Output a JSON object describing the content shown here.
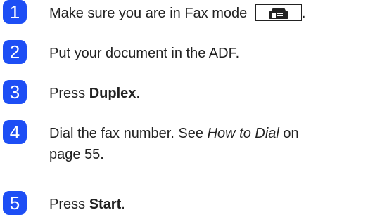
{
  "steps": [
    {
      "number": "1",
      "text_before": "Make sure you are in Fax mode",
      "key_icon": "fax-mode-icon",
      "text_after": "."
    },
    {
      "number": "2",
      "text": "Put your document in the ADF."
    },
    {
      "number": "3",
      "prefix": "Press",
      "bold": "Duplex",
      "suffix": "."
    },
    {
      "number": "4",
      "line1_prefix": "Dial the fax number. See",
      "italic": "How to Dial",
      "line1_suffix": "on",
      "line2": "page 55."
    },
    {
      "number": "5",
      "prefix": "Press",
      "bold": "Start",
      "suffix": "."
    }
  ],
  "colors": {
    "badge": "#1d4ef5",
    "text": "#222222"
  }
}
